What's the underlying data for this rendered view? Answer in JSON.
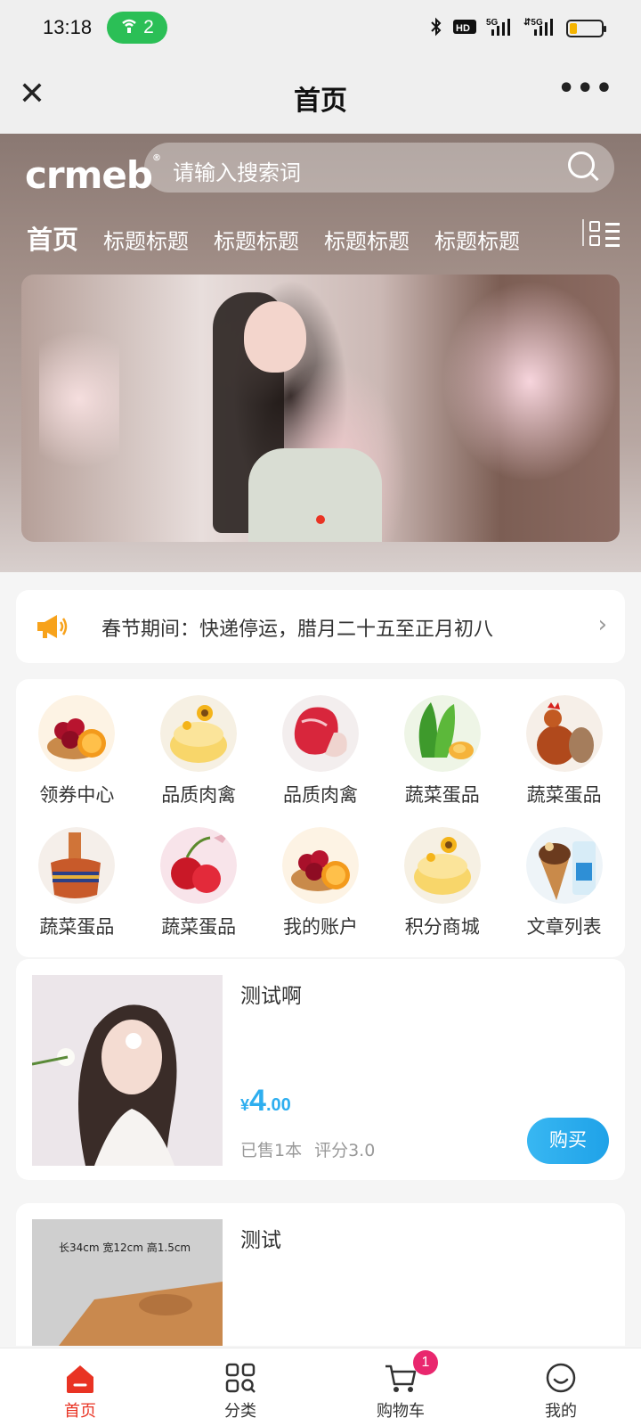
{
  "status_bar": {
    "time": "13:18",
    "hotspot_count": "2",
    "icons": [
      "bluetooth-icon",
      "hd-icon",
      "5g-signal-icon",
      "5g-signal-icon",
      "battery-icon"
    ]
  },
  "nav": {
    "title": "首页",
    "close_icon": "close-icon",
    "more_icon": "more-icon"
  },
  "header": {
    "logo": "crmeb",
    "search_placeholder": "请输入搜索词",
    "tabs": [
      "首页",
      "标题标题",
      "标题标题",
      "标题标题",
      "标题标题"
    ],
    "active_tab_index": 0
  },
  "banner": {
    "slides": 1,
    "active_slide": 0,
    "active_dot_color": "#e93323"
  },
  "notice": {
    "text": "春节期间：快递停运，腊月二十五至正月初八"
  },
  "menu": {
    "items": [
      {
        "label": "领券中心",
        "icon": "cherry-orange-icon"
      },
      {
        "label": "品质肉禽",
        "icon": "cake-icon"
      },
      {
        "label": "品质肉禽",
        "icon": "meat-icon"
      },
      {
        "label": "蔬菜蛋品",
        "icon": "vegetable-egg-icon"
      },
      {
        "label": "蔬菜蛋品",
        "icon": "rooster-icon"
      },
      {
        "label": "蔬菜蛋品",
        "icon": "hotpot-icon"
      },
      {
        "label": "蔬菜蛋品",
        "icon": "cherry-icon"
      },
      {
        "label": "我的账户",
        "icon": "cherry-orange-icon"
      },
      {
        "label": "积分商城",
        "icon": "cake-icon"
      },
      {
        "label": "文章列表",
        "icon": "ice-cream-icon"
      }
    ]
  },
  "products": [
    {
      "name": "测试啊",
      "price_symbol": "¥",
      "price_int": "4",
      "price_dec": ".00",
      "sold": "已售1本",
      "rating": "评分3.0",
      "buy_label": "购买"
    },
    {
      "name": "测试",
      "image_text": "长34cm 宽12cm 高1.5cm"
    }
  ],
  "tab_bar": {
    "items": [
      {
        "label": "首页",
        "icon": "home-icon"
      },
      {
        "label": "分类",
        "icon": "category-icon"
      },
      {
        "label": "购物车",
        "icon": "cart-icon"
      },
      {
        "label": "我的",
        "icon": "user-icon"
      }
    ],
    "active_index": 0,
    "cart_badge": "1"
  },
  "colors": {
    "accent": "#e93323",
    "price": "#2eaeef",
    "buy_button": "#2aabee",
    "hotspot": "#2bbf56",
    "badge": "#e9276e"
  }
}
